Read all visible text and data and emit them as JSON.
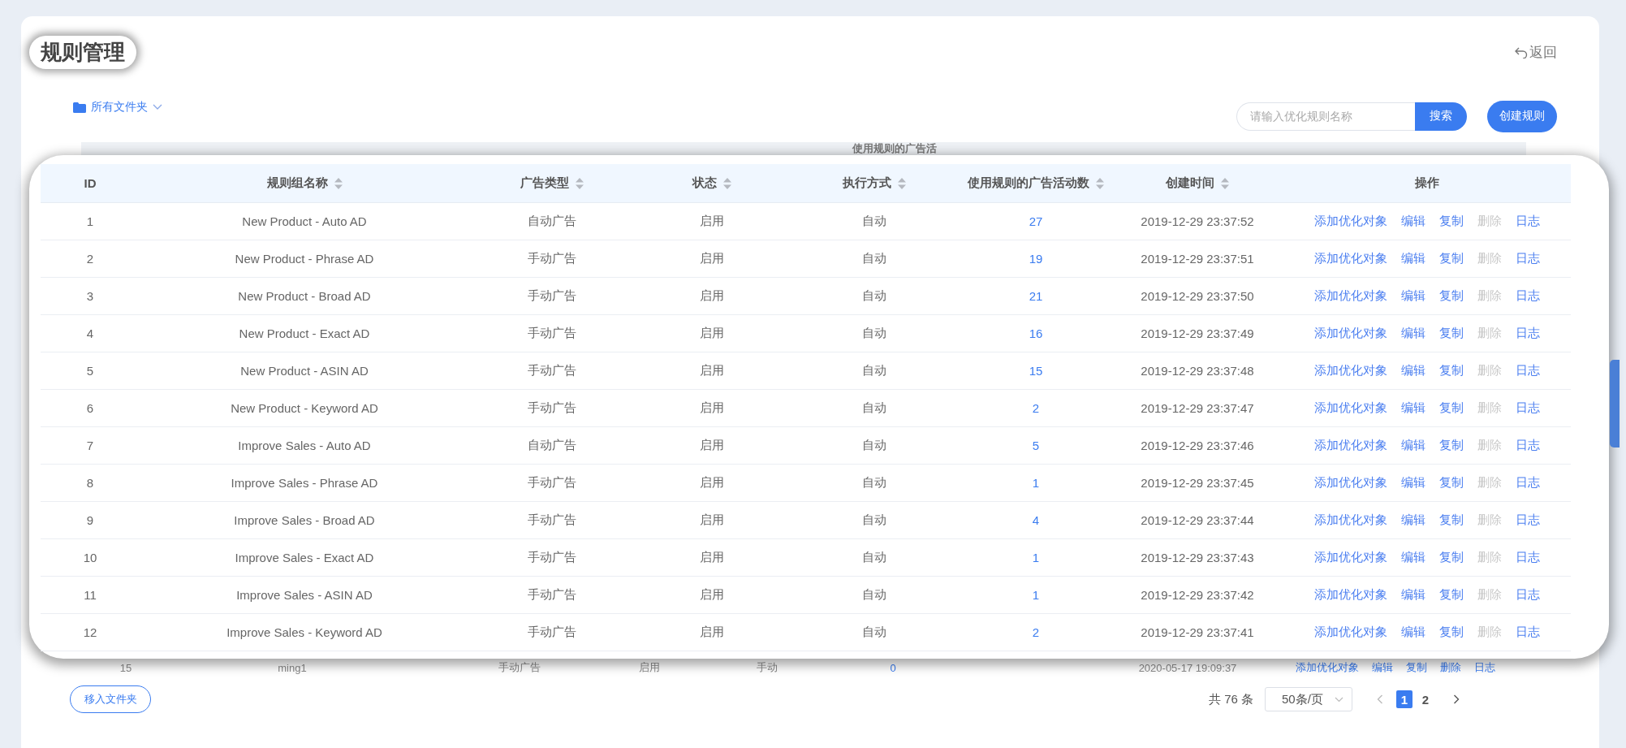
{
  "page": {
    "title": "规则管理",
    "back": "返回"
  },
  "toolbar": {
    "folder": "所有文件夹",
    "search": {
      "placeholder": "请输入优化规则名称",
      "button": "搜索"
    },
    "create": "创建规则"
  },
  "backdrop": {
    "header_fragment": "使用规则的广告活",
    "row": {
      "id": "15",
      "name": "ming1",
      "ad_type": "手动广告",
      "status": "启用",
      "mode": "手动",
      "count": "0",
      "created": "2020-05-17 19:09:37",
      "actions": [
        "添加优化对象",
        "编辑",
        "复制",
        "删除",
        "日志"
      ]
    }
  },
  "table": {
    "columns": [
      {
        "label": "ID",
        "sortable": false
      },
      {
        "label": "规则组名称",
        "sortable": true
      },
      {
        "label": "广告类型",
        "sortable": true
      },
      {
        "label": "状态",
        "sortable": true
      },
      {
        "label": "执行方式",
        "sortable": true
      },
      {
        "label": "使用规则的广告活动数",
        "sortable": true
      },
      {
        "label": "创建时间",
        "sortable": true
      },
      {
        "label": "操作",
        "sortable": false
      }
    ],
    "rows": [
      {
        "id": "1",
        "name": "New Product - Auto AD",
        "ad_type": "自动广告",
        "status": "启用",
        "mode": "自动",
        "count": "27",
        "created": "2019-12-29 23:37:52",
        "actions": [
          {
            "label": "添加优化对象",
            "disabled": false
          },
          {
            "label": "编辑",
            "disabled": false
          },
          {
            "label": "复制",
            "disabled": false
          },
          {
            "label": "删除",
            "disabled": true
          },
          {
            "label": "日志",
            "disabled": false
          }
        ]
      },
      {
        "id": "2",
        "name": "New Product - Phrase AD",
        "ad_type": "手动广告",
        "status": "启用",
        "mode": "自动",
        "count": "19",
        "created": "2019-12-29 23:37:51",
        "actions": [
          {
            "label": "添加优化对象",
            "disabled": false
          },
          {
            "label": "编辑",
            "disabled": false
          },
          {
            "label": "复制",
            "disabled": false
          },
          {
            "label": "删除",
            "disabled": true
          },
          {
            "label": "日志",
            "disabled": false
          }
        ]
      },
      {
        "id": "3",
        "name": "New Product - Broad AD",
        "ad_type": "手动广告",
        "status": "启用",
        "mode": "自动",
        "count": "21",
        "created": "2019-12-29 23:37:50",
        "actions": [
          {
            "label": "添加优化对象",
            "disabled": false
          },
          {
            "label": "编辑",
            "disabled": false
          },
          {
            "label": "复制",
            "disabled": false
          },
          {
            "label": "删除",
            "disabled": true
          },
          {
            "label": "日志",
            "disabled": false
          }
        ]
      },
      {
        "id": "4",
        "name": "New Product - Exact AD",
        "ad_type": "手动广告",
        "status": "启用",
        "mode": "自动",
        "count": "16",
        "created": "2019-12-29 23:37:49",
        "actions": [
          {
            "label": "添加优化对象",
            "disabled": false
          },
          {
            "label": "编辑",
            "disabled": false
          },
          {
            "label": "复制",
            "disabled": false
          },
          {
            "label": "删除",
            "disabled": true
          },
          {
            "label": "日志",
            "disabled": false
          }
        ]
      },
      {
        "id": "5",
        "name": "New Product - ASIN AD",
        "ad_type": "手动广告",
        "status": "启用",
        "mode": "自动",
        "count": "15",
        "created": "2019-12-29 23:37:48",
        "actions": [
          {
            "label": "添加优化对象",
            "disabled": false
          },
          {
            "label": "编辑",
            "disabled": false
          },
          {
            "label": "复制",
            "disabled": false
          },
          {
            "label": "删除",
            "disabled": true
          },
          {
            "label": "日志",
            "disabled": false
          }
        ]
      },
      {
        "id": "6",
        "name": "New Product - Keyword AD",
        "ad_type": "手动广告",
        "status": "启用",
        "mode": "自动",
        "count": "2",
        "created": "2019-12-29 23:37:47",
        "actions": [
          {
            "label": "添加优化对象",
            "disabled": false
          },
          {
            "label": "编辑",
            "disabled": false
          },
          {
            "label": "复制",
            "disabled": false
          },
          {
            "label": "删除",
            "disabled": true
          },
          {
            "label": "日志",
            "disabled": false
          }
        ]
      },
      {
        "id": "7",
        "name": "Improve Sales - Auto AD",
        "ad_type": "自动广告",
        "status": "启用",
        "mode": "自动",
        "count": "5",
        "created": "2019-12-29 23:37:46",
        "actions": [
          {
            "label": "添加优化对象",
            "disabled": false
          },
          {
            "label": "编辑",
            "disabled": false
          },
          {
            "label": "复制",
            "disabled": false
          },
          {
            "label": "删除",
            "disabled": true
          },
          {
            "label": "日志",
            "disabled": false
          }
        ]
      },
      {
        "id": "8",
        "name": "Improve Sales - Phrase AD",
        "ad_type": "手动广告",
        "status": "启用",
        "mode": "自动",
        "count": "1",
        "created": "2019-12-29 23:37:45",
        "actions": [
          {
            "label": "添加优化对象",
            "disabled": false
          },
          {
            "label": "编辑",
            "disabled": false
          },
          {
            "label": "复制",
            "disabled": false
          },
          {
            "label": "删除",
            "disabled": true
          },
          {
            "label": "日志",
            "disabled": false
          }
        ]
      },
      {
        "id": "9",
        "name": "Improve Sales - Broad AD",
        "ad_type": "手动广告",
        "status": "启用",
        "mode": "自动",
        "count": "4",
        "created": "2019-12-29 23:37:44",
        "actions": [
          {
            "label": "添加优化对象",
            "disabled": false
          },
          {
            "label": "编辑",
            "disabled": false
          },
          {
            "label": "复制",
            "disabled": false
          },
          {
            "label": "删除",
            "disabled": true
          },
          {
            "label": "日志",
            "disabled": false
          }
        ]
      },
      {
        "id": "10",
        "name": "Improve Sales - Exact AD",
        "ad_type": "手动广告",
        "status": "启用",
        "mode": "自动",
        "count": "1",
        "created": "2019-12-29 23:37:43",
        "actions": [
          {
            "label": "添加优化对象",
            "disabled": false
          },
          {
            "label": "编辑",
            "disabled": false
          },
          {
            "label": "复制",
            "disabled": false
          },
          {
            "label": "删除",
            "disabled": true
          },
          {
            "label": "日志",
            "disabled": false
          }
        ]
      },
      {
        "id": "11",
        "name": "Improve Sales - ASIN AD",
        "ad_type": "手动广告",
        "status": "启用",
        "mode": "自动",
        "count": "1",
        "created": "2019-12-29 23:37:42",
        "actions": [
          {
            "label": "添加优化对象",
            "disabled": false
          },
          {
            "label": "编辑",
            "disabled": false
          },
          {
            "label": "复制",
            "disabled": false
          },
          {
            "label": "删除",
            "disabled": true
          },
          {
            "label": "日志",
            "disabled": false
          }
        ]
      },
      {
        "id": "12",
        "name": "Improve Sales - Keyword AD",
        "ad_type": "手动广告",
        "status": "启用",
        "mode": "自动",
        "count": "2",
        "created": "2019-12-29 23:37:41",
        "actions": [
          {
            "label": "添加优化对象",
            "disabled": false
          },
          {
            "label": "编辑",
            "disabled": false
          },
          {
            "label": "复制",
            "disabled": false
          },
          {
            "label": "删除",
            "disabled": true
          },
          {
            "label": "日志",
            "disabled": false
          }
        ]
      }
    ]
  },
  "footer": {
    "move_button": "移入文件夹",
    "total": "共 76 条",
    "page_size": "50条/页",
    "pages": [
      {
        "label": "1",
        "selected": true
      },
      {
        "label": "2",
        "selected": false
      }
    ]
  }
}
